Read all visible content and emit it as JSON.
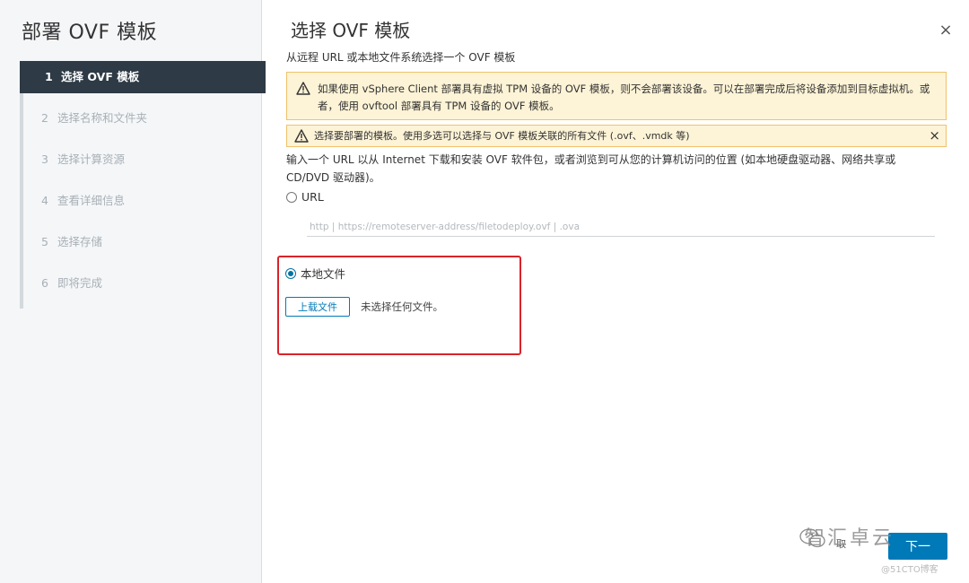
{
  "wizard": {
    "title": "部署 OVF 模板",
    "steps": [
      {
        "num": "1",
        "label": "选择 OVF 模板"
      },
      {
        "num": "2",
        "label": "选择名称和文件夹"
      },
      {
        "num": "3",
        "label": "选择计算资源"
      },
      {
        "num": "4",
        "label": "查看详细信息"
      },
      {
        "num": "5",
        "label": "选择存储"
      },
      {
        "num": "6",
        "label": "即将完成"
      }
    ],
    "active_step": 1
  },
  "page": {
    "title": "选择 OVF 模板",
    "subtitle": "从远程 URL 或本地文件系统选择一个 OVF 模板",
    "close_icon": "×"
  },
  "alerts": {
    "tpm_warning": "如果使用 vSphere Client 部署具有虚拟 TPM 设备的 OVF 模板，则不会部署该设备。可以在部署完成后将设备添加到目标虚拟机。或者，使用 ovftool 部署具有 TPM 设备的 OVF 模板。",
    "select_warning": "选择要部署的模板。使用多选可以选择与 OVF 模板关联的所有文件 (.ovf、.vmdk 等)",
    "close_icon": "×"
  },
  "source": {
    "description": "输入一个 URL 以从 Internet 下载和安装 OVF 软件包，或者浏览到可从您的计算机访问的位置 (如本地硬盘驱动器、网络共享或 CD/DVD 驱动器)。",
    "url_option_label": "URL",
    "url_placeholder": "http | https://remoteserver-address/filetodeploy.ovf | .ova",
    "url_value": "",
    "local_option_label": "本地文件",
    "selected_option": "local",
    "upload_button": "上载文件",
    "no_file_text": "未选择任何文件。"
  },
  "footer": {
    "cancel_label": "取",
    "next_label": "下一"
  },
  "watermark": {
    "text": "智汇卓云",
    "source": "@51CTO博客"
  },
  "colors": {
    "accent": "#0079b8",
    "active_step_bg": "#2e3a45",
    "warning_bg": "#fdf3d6",
    "warning_border": "#f0c26b",
    "highlight": "#d9232a"
  }
}
